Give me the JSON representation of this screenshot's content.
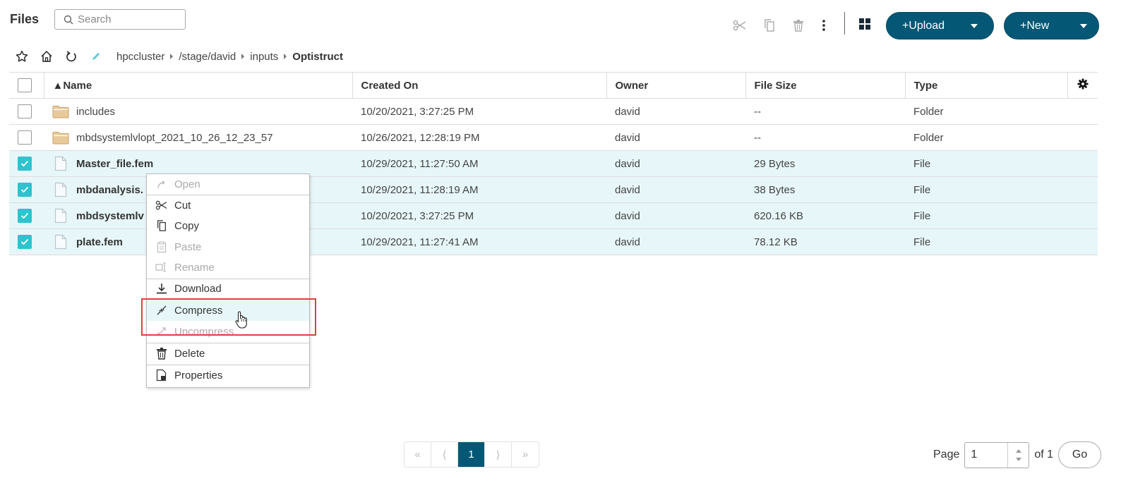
{
  "header": {
    "title": "Files",
    "search_placeholder": "Search",
    "toolbar": {
      "cut_icon": "scissors-icon",
      "copy_icon": "copy-icon",
      "delete_icon": "trash-icon",
      "more_icon": "kebab-icon",
      "view_icon": "grid-view-icon"
    },
    "upload_label": "+Upload",
    "new_label": "+New"
  },
  "breadcrumb": {
    "icons": [
      "star-icon",
      "home-icon",
      "refresh-icon",
      "edit-icon"
    ],
    "items": [
      "hpccluster",
      "/stage/david",
      "inputs",
      "Optistruct"
    ]
  },
  "table": {
    "columns": [
      "▲Name",
      "Created On",
      "Owner",
      "File Size",
      "Type"
    ],
    "rows": [
      {
        "name": "includes",
        "created": "10/20/2021, 3:27:25 PM",
        "owner": "david",
        "size": "--",
        "type": "Folder",
        "selected": false,
        "kind": "folder"
      },
      {
        "name": "mbdsystemlvlopt_2021_10_26_12_23_57",
        "created": "10/26/2021, 12:28:19 PM",
        "owner": "david",
        "size": "--",
        "type": "Folder",
        "selected": false,
        "kind": "folder"
      },
      {
        "name": "Master_file.fem",
        "created": "10/29/2021, 11:27:50 AM",
        "owner": "david",
        "size": "29 Bytes",
        "type": "File",
        "selected": true,
        "kind": "file"
      },
      {
        "name": "mbdanalysis.",
        "created": "10/29/2021, 11:28:19 AM",
        "owner": "david",
        "size": "38 Bytes",
        "type": "File",
        "selected": true,
        "kind": "file"
      },
      {
        "name": "mbdsystemlv",
        "created": "10/20/2021, 3:27:25 PM",
        "owner": "david",
        "size": "620.16 KB",
        "type": "File",
        "selected": true,
        "kind": "file"
      },
      {
        "name": "plate.fem",
        "created": "10/29/2021, 11:27:41 AM",
        "owner": "david",
        "size": "78.12 KB",
        "type": "File",
        "selected": true,
        "kind": "file"
      }
    ]
  },
  "context_menu": {
    "items": [
      {
        "label": "Open",
        "disabled": true
      },
      {
        "label": "Cut",
        "disabled": false
      },
      {
        "label": "Copy",
        "disabled": false
      },
      {
        "label": "Paste",
        "disabled": true
      },
      {
        "label": "Rename",
        "disabled": true
      },
      {
        "label": "Download",
        "disabled": false
      },
      {
        "label": "Compress",
        "disabled": false,
        "highlighted": true
      },
      {
        "label": "Uncompress",
        "disabled": true
      },
      {
        "label": "Delete",
        "disabled": false
      },
      {
        "label": "Properties",
        "disabled": false
      }
    ]
  },
  "pagination": {
    "first": "«",
    "prev": "⟨",
    "current": "1",
    "next": "⟩",
    "last": "»",
    "page_label": "Page",
    "page_value": "1",
    "of_label": "of 1",
    "go_label": "Go"
  },
  "colors": {
    "primary": "#045876",
    "checkbox": "#2bc4cf",
    "selected_row": "#e7f7f9",
    "highlight_box": "#e04040"
  }
}
